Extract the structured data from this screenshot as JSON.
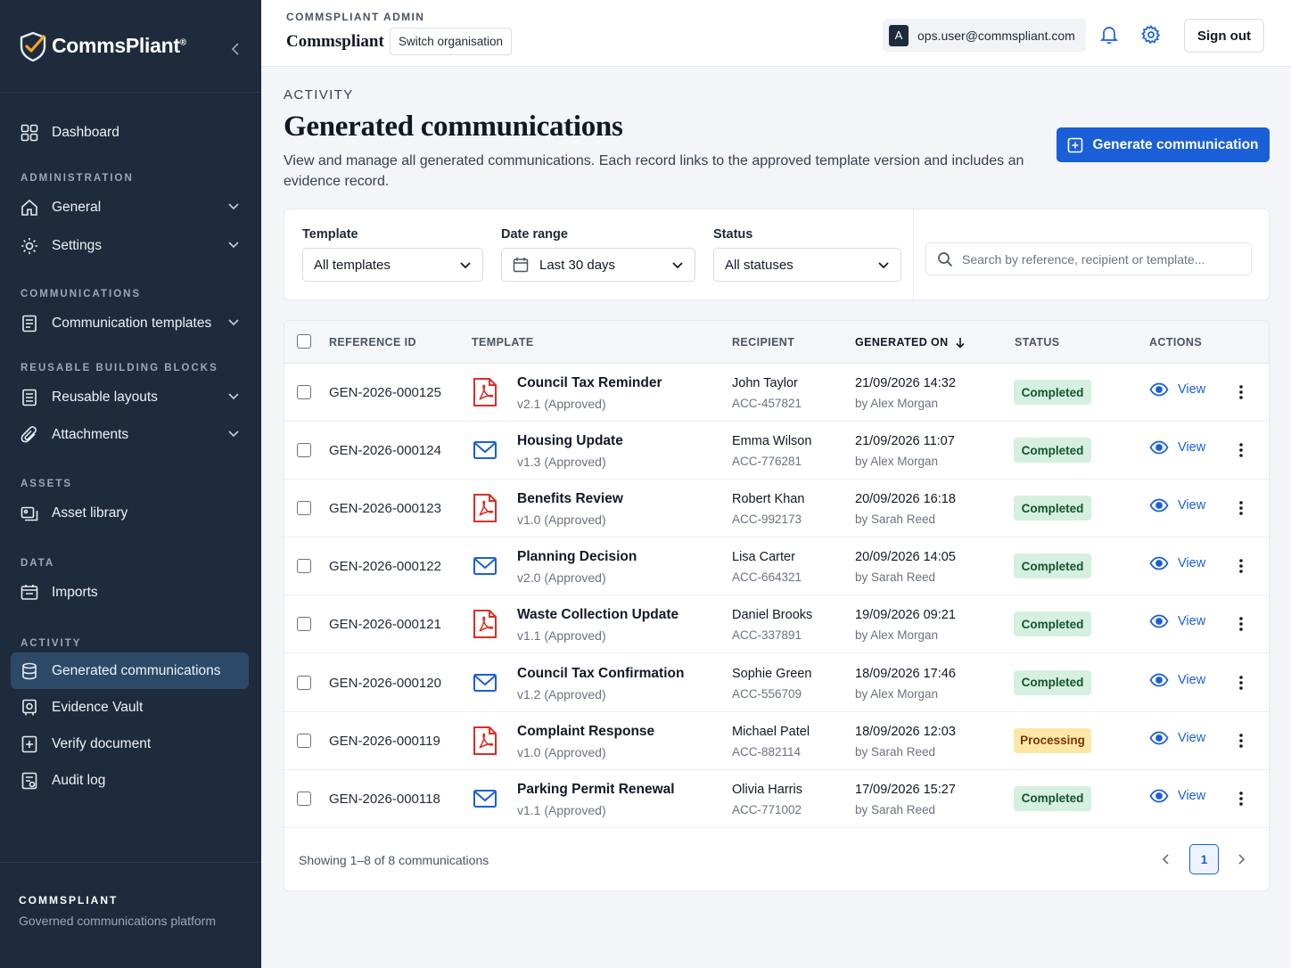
{
  "sidebar": {
    "brand": "CommsPliant",
    "brand_mark": "®",
    "nav": {
      "dashboard": "Dashboard",
      "section_admin": "ADMINISTRATION",
      "general": "General",
      "settings": "Settings",
      "section_comms": "COMMUNICATIONS",
      "comm_templates": "Communication templates",
      "section_blocks": "REUSABLE BUILDING BLOCKS",
      "reusable_layouts": "Reusable layouts",
      "attachments": "Attachments",
      "section_assets": "ASSETS",
      "asset_library": "Asset library",
      "section_data": "DATA",
      "imports": "Imports",
      "section_activity": "ACTIVITY",
      "generated_comms": "Generated communications",
      "evidence_vault": "Evidence Vault",
      "verify_document": "Verify document",
      "audit_log": "Audit log"
    },
    "footer": {
      "title": "COMMSPLIANT",
      "subtitle": "Governed communications platform"
    }
  },
  "topbar": {
    "admin_label": "COMMSPLIANT ADMIN",
    "org_name": "Commspliant",
    "switch_org": "Switch organisation",
    "avatar_letter": "A",
    "user_email": "ops.user@commspliant.com",
    "signout": "Sign out"
  },
  "header": {
    "section": "ACTIVITY",
    "title": "Generated communications",
    "description": "View and manage all generated communications. Each record links to the approved template version and includes an evidence record.",
    "generate_button": "Generate communication"
  },
  "filters": {
    "template_label": "Template",
    "template_value": "All templates",
    "date_label": "Date range",
    "date_value": "Last 30 days",
    "status_label": "Status",
    "status_value": "All statuses",
    "search_placeholder": "Search by reference, recipient or template..."
  },
  "table": {
    "columns": {
      "reference": "REFERENCE ID",
      "template": "TEMPLATE",
      "recipient": "RECIPIENT",
      "generated_on": "GENERATED ON",
      "status": "STATUS",
      "actions": "ACTIONS"
    },
    "view_label": "View",
    "rows": [
      {
        "ref": "GEN-2026-000125",
        "type": "pdf",
        "template": "Council Tax Reminder",
        "version": "v2.1 (Approved)",
        "recipient": "John Taylor",
        "account": "ACC-457821",
        "date": "21/09/2026 14:32",
        "by": "by Alex Morgan",
        "status": "Completed"
      },
      {
        "ref": "GEN-2026-000124",
        "type": "email",
        "template": "Housing Update",
        "version": "v1.3 (Approved)",
        "recipient": "Emma Wilson",
        "account": "ACC-776281",
        "date": "21/09/2026 11:07",
        "by": "by Alex Morgan",
        "status": "Completed"
      },
      {
        "ref": "GEN-2026-000123",
        "type": "pdf",
        "template": "Benefits Review",
        "version": "v1.0 (Approved)",
        "recipient": "Robert Khan",
        "account": "ACC-992173",
        "date": "20/09/2026 16:18",
        "by": "by Sarah Reed",
        "status": "Completed"
      },
      {
        "ref": "GEN-2026-000122",
        "type": "email",
        "template": "Planning Decision",
        "version": "v2.0 (Approved)",
        "recipient": "Lisa Carter",
        "account": "ACC-664321",
        "date": "20/09/2026 14:05",
        "by": "by Sarah Reed",
        "status": "Completed"
      },
      {
        "ref": "GEN-2026-000121",
        "type": "pdf",
        "template": "Waste Collection Update",
        "version": "v1.1 (Approved)",
        "recipient": "Daniel Brooks",
        "account": "ACC-337891",
        "date": "19/09/2026 09:21",
        "by": "by Alex Morgan",
        "status": "Completed"
      },
      {
        "ref": "GEN-2026-000120",
        "type": "email",
        "template": "Council Tax Confirmation",
        "version": "v1.2 (Approved)",
        "recipient": "Sophie Green",
        "account": "ACC-556709",
        "date": "18/09/2026 17:46",
        "by": "by Alex Morgan",
        "status": "Completed"
      },
      {
        "ref": "GEN-2026-000119",
        "type": "pdf",
        "template": "Complaint Response",
        "version": "v1.0 (Approved)",
        "recipient": "Michael Patel",
        "account": "ACC-882114",
        "date": "18/09/2026 12:03",
        "by": "by Sarah Reed",
        "status": "Processing"
      },
      {
        "ref": "GEN-2026-000118",
        "type": "email",
        "template": "Parking Permit Renewal",
        "version": "v1.1 (Approved)",
        "recipient": "Olivia Harris",
        "account": "ACC-771002",
        "date": "17/09/2026 15:27",
        "by": "by Sarah Reed",
        "status": "Completed"
      }
    ],
    "footer_text": "Showing 1–8 of 8 communications",
    "current_page": "1"
  },
  "colors": {
    "sidebar_bg": "#1e2b3c",
    "accent": "#1a5fd8",
    "pdf_red": "#d93025",
    "completed_bg": "#d5f0e0",
    "processing_bg": "#fce7a6"
  }
}
